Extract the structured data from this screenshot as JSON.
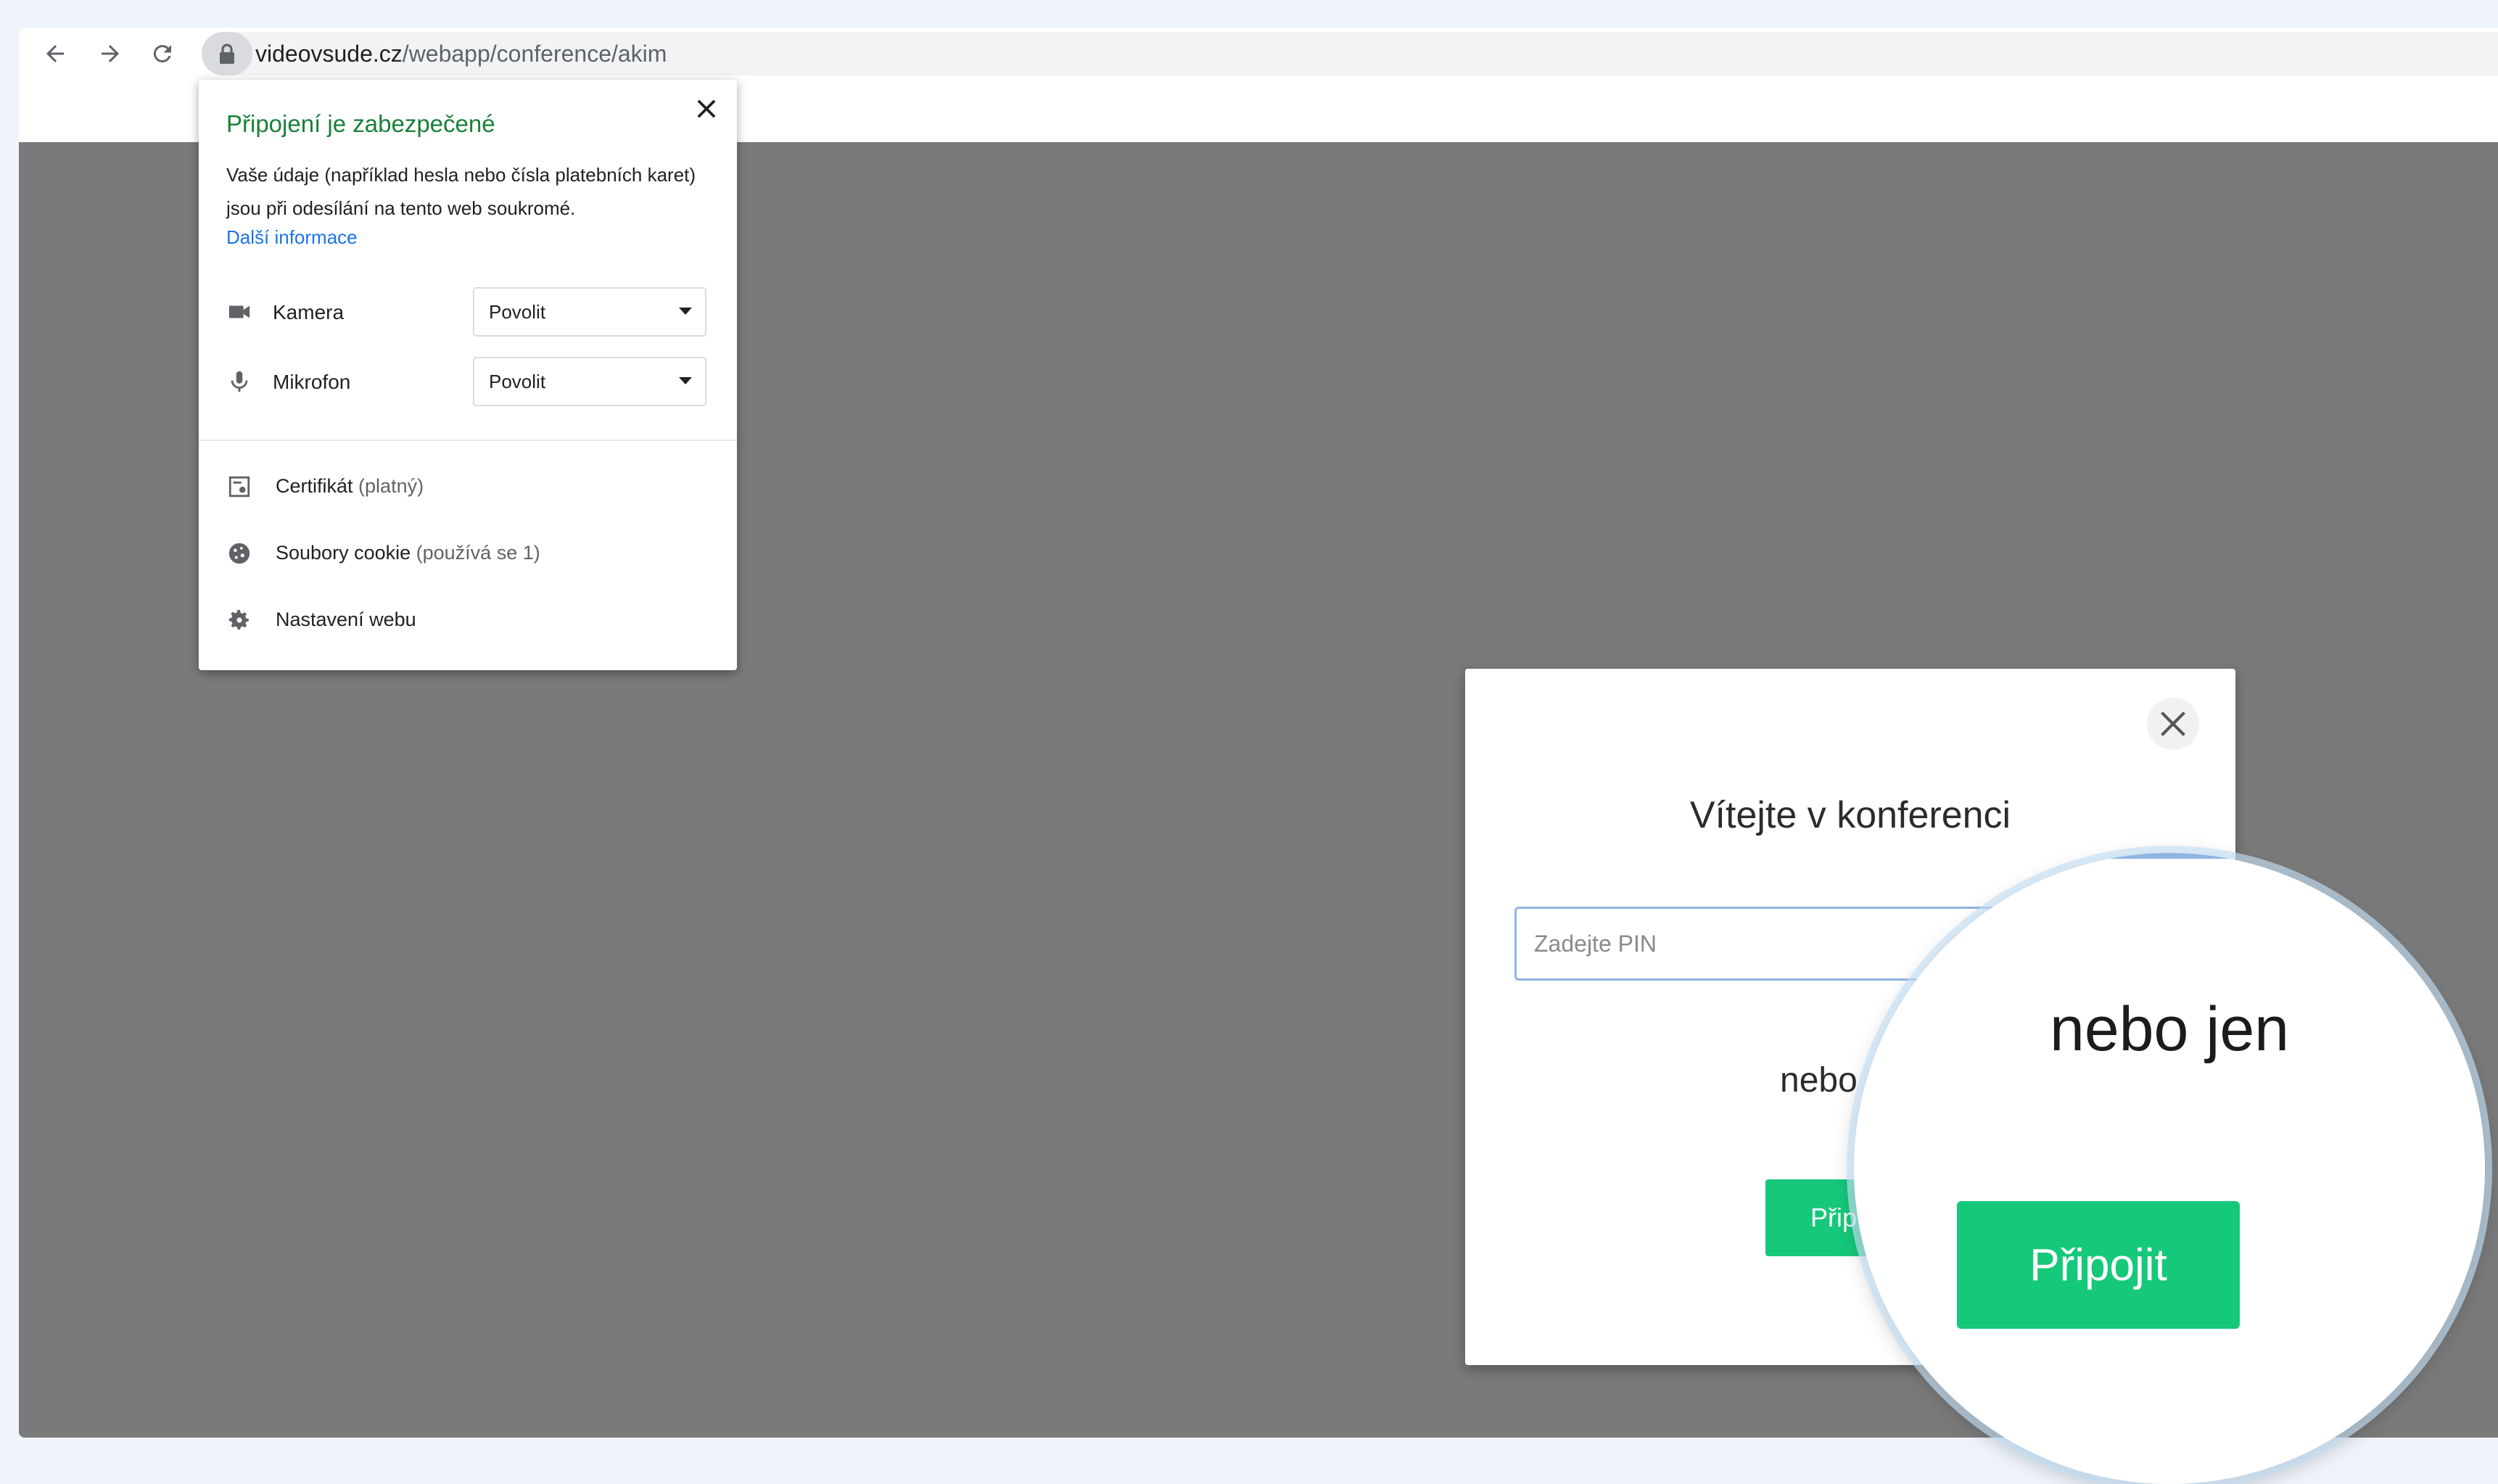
{
  "browser": {
    "url_host": "videovsude.cz",
    "url_path": "/webapp/conference/akim",
    "icons": [
      "back-arrow-icon",
      "forward-arrow-icon",
      "reload-icon",
      "lock-icon"
    ]
  },
  "site_info": {
    "title": "Připojení je zabezpečené",
    "description": "Vaše údaje (například hesla nebo čísla platebních karet) jsou při odesílání na tento web soukromé.",
    "learn_more": "Další informace",
    "permissions": [
      {
        "label": "Kamera",
        "value": "Povolit",
        "icon": "camera-icon"
      },
      {
        "label": "Mikrofon",
        "value": "Povolit",
        "icon": "microphone-icon"
      }
    ],
    "items": [
      {
        "label": "Certifikát",
        "sub": "(platný)",
        "icon": "certificate-icon"
      },
      {
        "label": "Soubory cookie",
        "sub": "(používá se 1)",
        "icon": "cookie-icon"
      },
      {
        "label": "Nastavení webu",
        "sub": "",
        "icon": "gear-icon"
      }
    ]
  },
  "conference_modal": {
    "title": "Vítejte v konferenci",
    "pin_placeholder": "Zadejte PIN",
    "or_text": "nebo",
    "join_button_partial": "Přip"
  },
  "magnifier": {
    "or_text": "nebo jen",
    "join_button": "Připojit"
  },
  "colors": {
    "secure_green": "#188038",
    "link_blue": "#1a73e8",
    "join_green": "#16c87a",
    "overlay_gray": "#7a7a7a"
  }
}
